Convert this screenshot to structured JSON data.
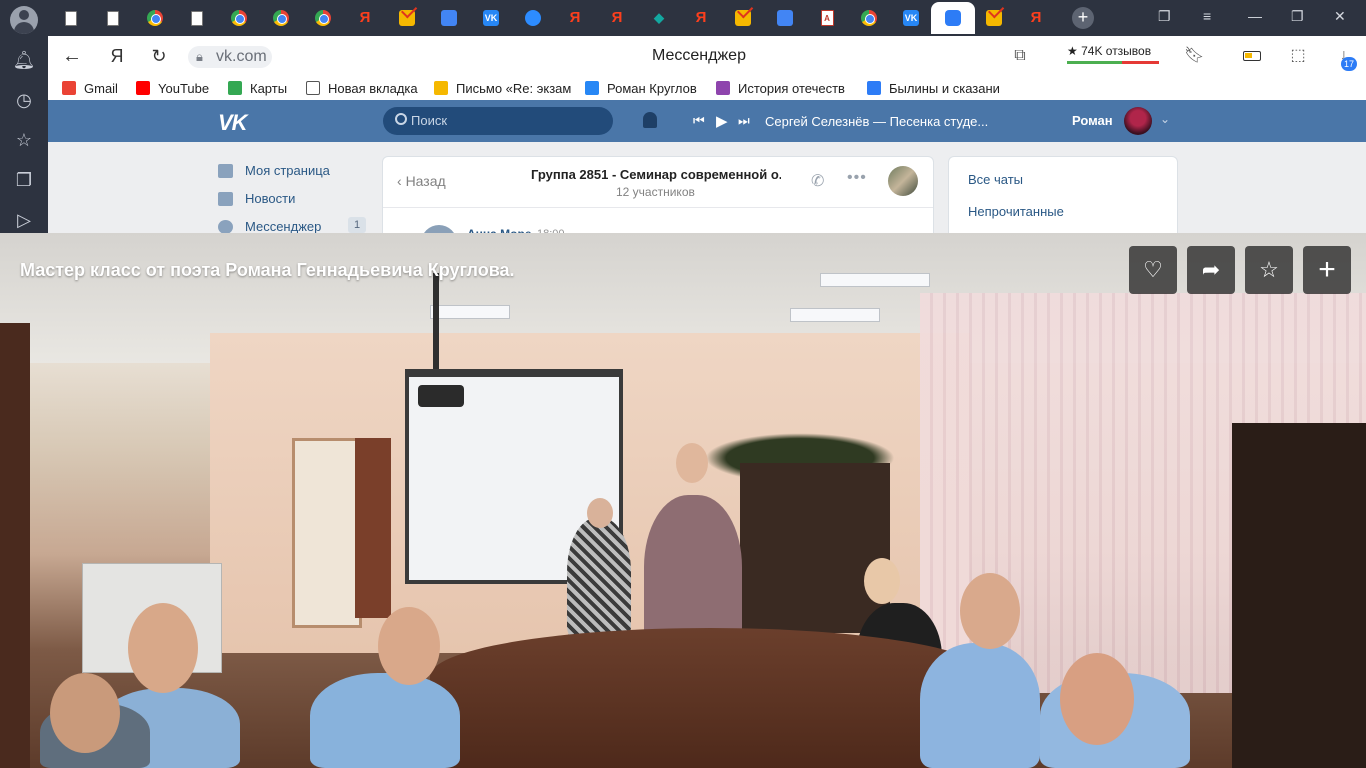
{
  "browser": {
    "address": "vk.com",
    "title": "Мессенджер",
    "reviews": "★ 74K отзывов",
    "downloads_badge": "17",
    "yandex_btn": "Я"
  },
  "tabs": [
    {
      "kind": "doc"
    },
    {
      "kind": "doc"
    },
    {
      "kind": "chrome"
    },
    {
      "kind": "doc"
    },
    {
      "kind": "chrome"
    },
    {
      "kind": "chrome"
    },
    {
      "kind": "chrome"
    },
    {
      "kind": "ya",
      "label": "Я"
    },
    {
      "kind": "mail"
    },
    {
      "kind": "gdoc"
    },
    {
      "kind": "vk",
      "label": "VK"
    },
    {
      "kind": "zoom"
    },
    {
      "kind": "ya",
      "label": "Я"
    },
    {
      "kind": "ya",
      "label": "Я"
    },
    {
      "kind": "teal",
      "label": "◆"
    },
    {
      "kind": "ya",
      "label": "Я"
    },
    {
      "kind": "mail"
    },
    {
      "kind": "gdoc"
    },
    {
      "kind": "pdf",
      "label": "A"
    },
    {
      "kind": "chrome"
    },
    {
      "kind": "vk",
      "label": "VK"
    },
    {
      "kind": "msg",
      "active": true
    },
    {
      "kind": "mail"
    },
    {
      "kind": "ya",
      "label": "Я"
    }
  ],
  "bookmarks": [
    {
      "label": "Gmail",
      "color": "#ea4335"
    },
    {
      "label": "YouTube",
      "color": "#ff0000"
    },
    {
      "label": "Карты",
      "color": "#34a853"
    },
    {
      "label": "Новая вкладка",
      "color": "#ffffff"
    },
    {
      "label": "Письмо «Re: экзам",
      "color": "#f5b800"
    },
    {
      "label": "Роман Круглов",
      "color": "#2787f5"
    },
    {
      "label": "История отечеств",
      "color": "#8e44ad"
    },
    {
      "label": "Былины и сказани",
      "color": "#2d7cf6"
    }
  ],
  "vk": {
    "logo": "VK",
    "search_placeholder": "Поиск",
    "player_prev": "⏮",
    "player_play": "▶",
    "player_next": "⏭",
    "track": "Сергей Селезнёв — Песенка студе...",
    "user_name": "Роман",
    "menu": [
      {
        "label": "Моя страница"
      },
      {
        "label": "Новости"
      },
      {
        "label": "Мессенджер",
        "count": "1"
      }
    ],
    "chat": {
      "back": "Назад",
      "title": "Группа 2851 - Семинар современной о...",
      "subtitle": "12 участников",
      "msg_author": "Анна Море",
      "msg_time": "18:00"
    },
    "right_panel": {
      "all_chats": "Все чаты",
      "unread": "Непрочитанные"
    }
  },
  "viewer": {
    "title": "Мастер класс от поэта Романа Геннадьевича Круглова.",
    "buttons": [
      {
        "name": "like-button",
        "icon": "heart-icon",
        "glyph": "♡"
      },
      {
        "name": "share-button",
        "icon": "share-icon",
        "glyph": "➦"
      },
      {
        "name": "favorite-button",
        "icon": "star-icon",
        "glyph": "☆"
      },
      {
        "name": "add-button",
        "icon": "plus-icon",
        "glyph": "+"
      }
    ]
  }
}
